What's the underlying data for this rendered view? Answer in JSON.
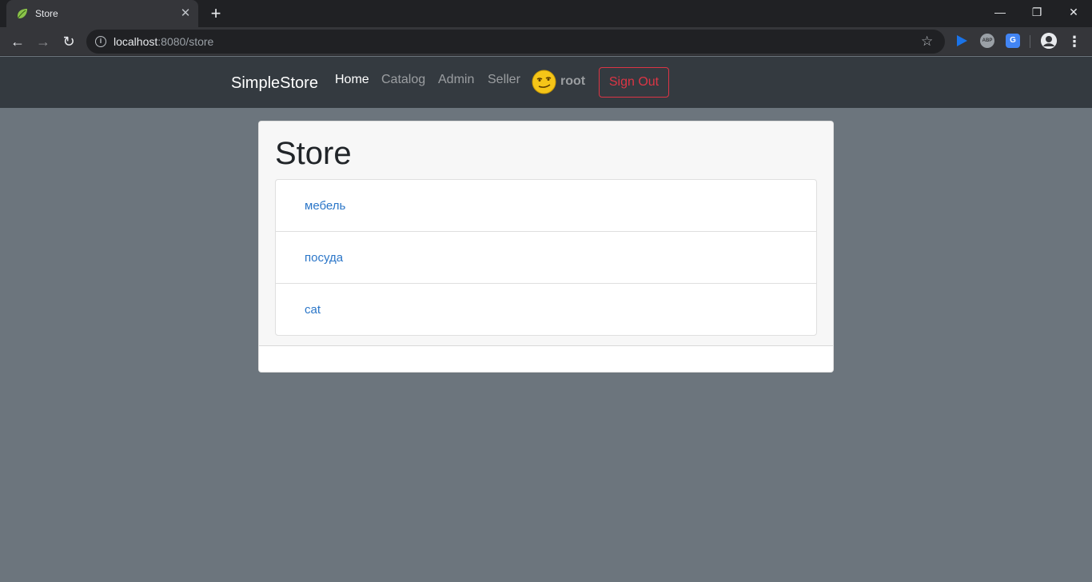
{
  "browser": {
    "tab_title": "Store",
    "tab_close": "✕",
    "new_tab": "+",
    "url_host": "localhost",
    "url_rest": ":8080/store",
    "ext_abp": "ABP",
    "ext_translate": "G"
  },
  "navbar": {
    "brand": "SimpleStore",
    "links": [
      "Home",
      "Catalog",
      "Admin",
      "Seller"
    ],
    "active_link": "Home",
    "username": "root",
    "signout_label": "Sign Out"
  },
  "store": {
    "title": "Store",
    "categories": [
      "мебель",
      "посуда",
      "cat"
    ]
  },
  "colors": {
    "navbar_bg": "#343a40",
    "page_bg": "#6c757d",
    "link": "#2b76c8",
    "danger": "#dc3545"
  }
}
